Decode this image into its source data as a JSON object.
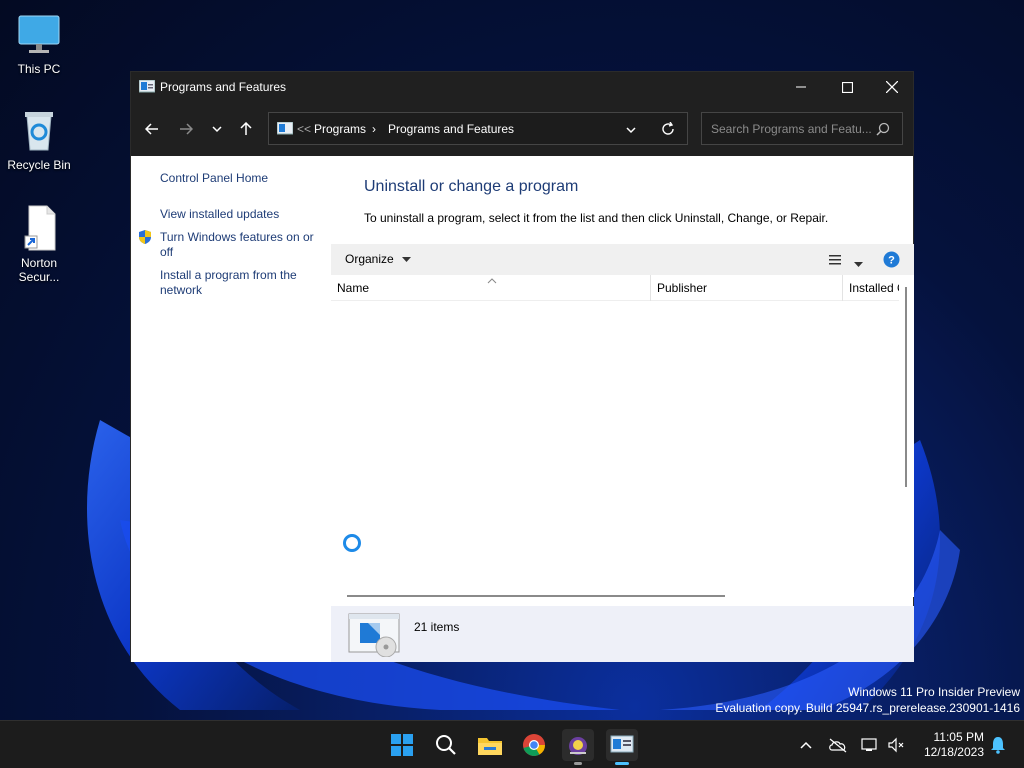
{
  "desktop": {
    "icons": [
      {
        "label": "This PC"
      },
      {
        "label": "Recycle Bin"
      },
      {
        "label": "Norton Secur..."
      }
    ]
  },
  "window": {
    "title": "Programs and Features",
    "breadcrumb": {
      "overflow": "<<",
      "items": [
        "Programs",
        "Programs and Features"
      ]
    },
    "search_placeholder": "Search Programs and Featu...",
    "left_links": [
      "Control Panel Home",
      "View installed updates",
      "Turn Windows features on or off",
      "Install a program from the network"
    ],
    "heading": "Uninstall or change a program",
    "description": "To uninstall a program, select it from the list and then click Uninstall, Change, or Repair.",
    "organize_label": "Organize",
    "columns": [
      "Name",
      "Publisher",
      "Installed O"
    ],
    "item_count": "21 items"
  },
  "watermark": {
    "line1": "Windows 11 Pro Insider Preview",
    "line2": "Evaluation copy. Build 25947.rs_prerelease.230901-1416"
  },
  "taskbar": {
    "apps": [
      "start-icon",
      "search-icon",
      "file-explorer-icon",
      "chrome-icon",
      "setup-wizard-icon",
      "control-panel-icon"
    ],
    "time": "11:05 PM",
    "date": "12/18/2023"
  },
  "colors": {
    "link": "#1e3c76",
    "titlebar": "#202020",
    "accent": "#0078d4"
  }
}
